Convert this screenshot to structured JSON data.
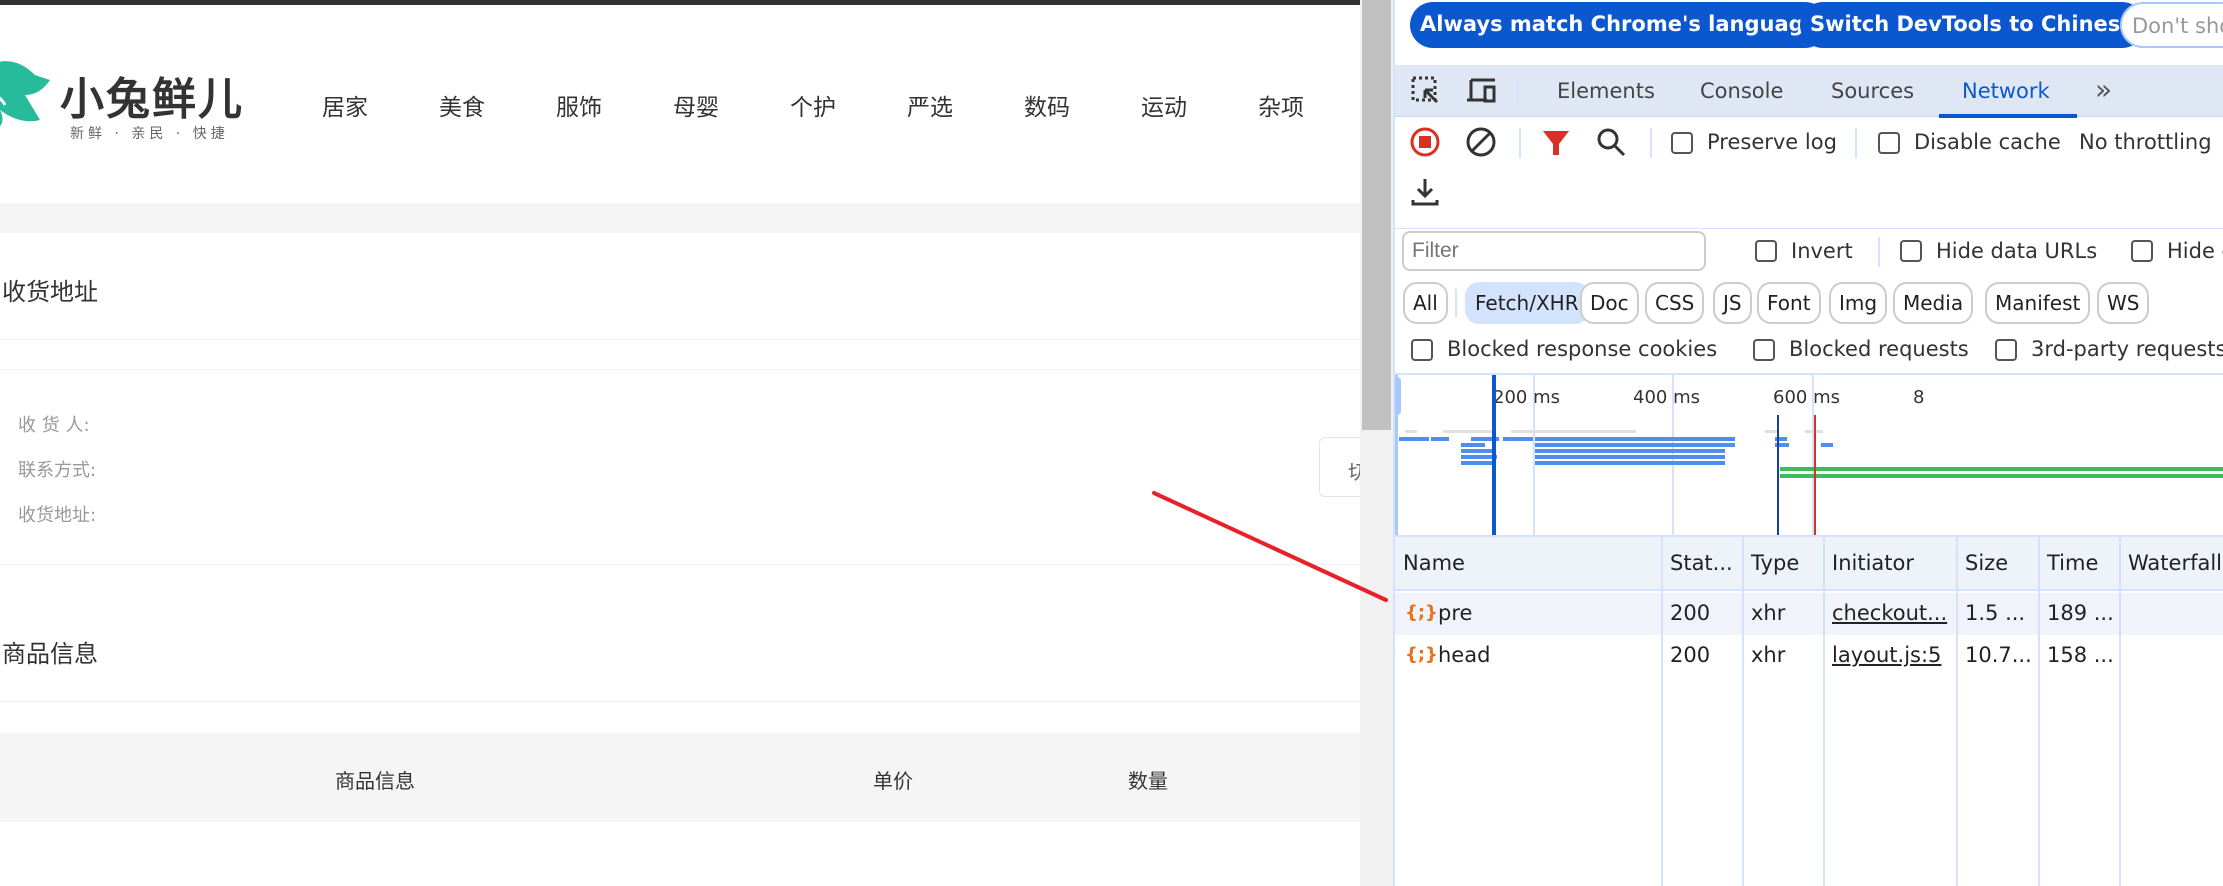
{
  "page": {
    "logo": {
      "name": "小兔鲜儿",
      "slogan": "新鲜 · 亲民 · 快捷",
      "brand_color": "#27ba9b"
    },
    "nav": [
      "居家",
      "美食",
      "服饰",
      "母婴",
      "个护",
      "严选",
      "数码",
      "运动",
      "杂项"
    ],
    "address_section": {
      "title": "收货地址",
      "labels": [
        "收 货 人:",
        "联系方式:",
        "收货地址:"
      ],
      "switch_button": "切"
    },
    "goods_section": {
      "title": "商品信息",
      "headers": [
        "商品信息",
        "单价",
        "数量"
      ]
    },
    "annotation_color": "#e8202a"
  },
  "devtools": {
    "infobar": {
      "buttons": [
        "Always match Chrome's language",
        "Switch DevTools to Chinese",
        "Don't sho"
      ]
    },
    "tabs": [
      "Elements",
      "Console",
      "Sources",
      "Network"
    ],
    "active_tab": "Network",
    "more_tabs": "»",
    "toolbar": {
      "icons": [
        "stop-recording-icon",
        "clear-icon",
        "filter-icon",
        "search-icon",
        "export-har-icon"
      ],
      "preserve_log": {
        "label": "Preserve log",
        "checked": false
      },
      "disable_cache": {
        "label": "Disable cache",
        "checked": false
      },
      "throttling": "No throttling"
    },
    "filter": {
      "placeholder": "Filter",
      "invert": {
        "label": "Invert",
        "checked": false
      },
      "hide_data_urls": {
        "label": "Hide data URLs",
        "checked": false
      },
      "hide_ext": {
        "label": "Hide e",
        "checked": false
      }
    },
    "type_chips": [
      "All",
      "Fetch/XHR",
      "Doc",
      "CSS",
      "JS",
      "Font",
      "Img",
      "Media",
      "Manifest",
      "WS"
    ],
    "active_chip": "Fetch/XHR",
    "blocked": {
      "response_cookies": {
        "label": "Blocked response cookies",
        "checked": false
      },
      "requests": {
        "label": "Blocked requests",
        "checked": false
      },
      "third_party": {
        "label": "3rd-party requests",
        "checked": false
      }
    },
    "overview": {
      "ticks": [
        "200 ms",
        "400 ms",
        "600 ms",
        "8"
      ]
    },
    "table": {
      "columns": [
        "Name",
        "Stat...",
        "Type",
        "Initiator",
        "Size",
        "Time",
        "Waterfall"
      ],
      "rows": [
        {
          "name": "pre",
          "status": "200",
          "type": "xhr",
          "initiator": "checkout...",
          "size": "1.5 ...",
          "time": "189 ..."
        },
        {
          "name": "head",
          "status": "200",
          "type": "xhr",
          "initiator": "layout.js:5",
          "size": "10.7...",
          "time": "158 ..."
        }
      ]
    }
  }
}
